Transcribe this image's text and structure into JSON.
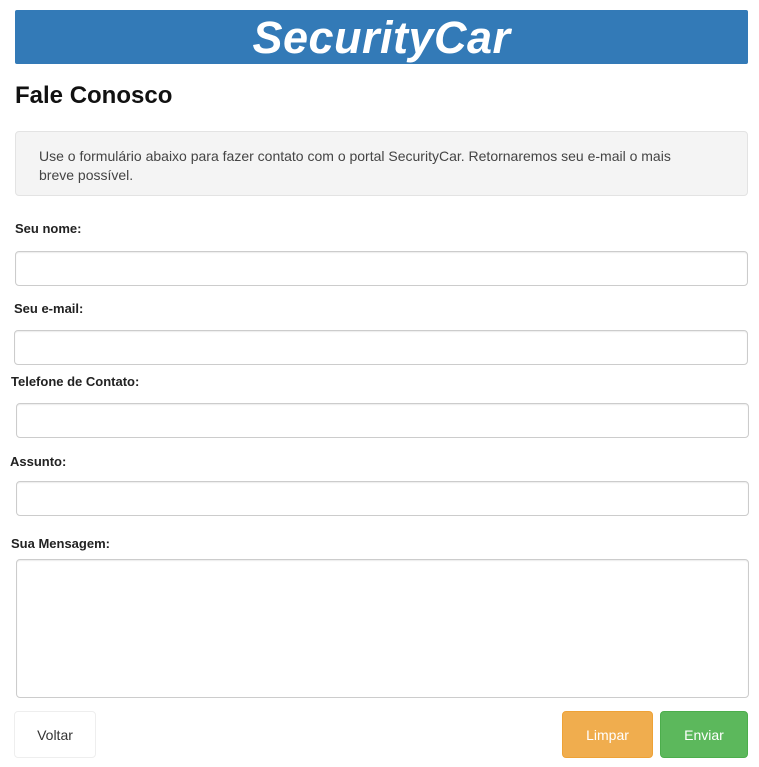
{
  "header": {
    "brand": "SecurityCar",
    "brand_color": "#337ab7"
  },
  "page": {
    "title": "Fale Conosco",
    "intro": "Use o formulário abaixo para fazer contato com o portal SecurityCar. Retornaremos seu e-mail o mais breve possível."
  },
  "form": {
    "name": {
      "label": "Seu nome:",
      "value": ""
    },
    "email": {
      "label": "Seu e-mail:",
      "value": ""
    },
    "phone": {
      "label": "Telefone de Contato:",
      "value": ""
    },
    "subject": {
      "label": "Assunto:",
      "value": ""
    },
    "message": {
      "label": "Sua Mensagem:",
      "value": ""
    }
  },
  "buttons": {
    "back": "Voltar",
    "clear": "Limpar",
    "send": "Enviar",
    "clear_color": "#f0ad4e",
    "send_color": "#5cb85c"
  }
}
